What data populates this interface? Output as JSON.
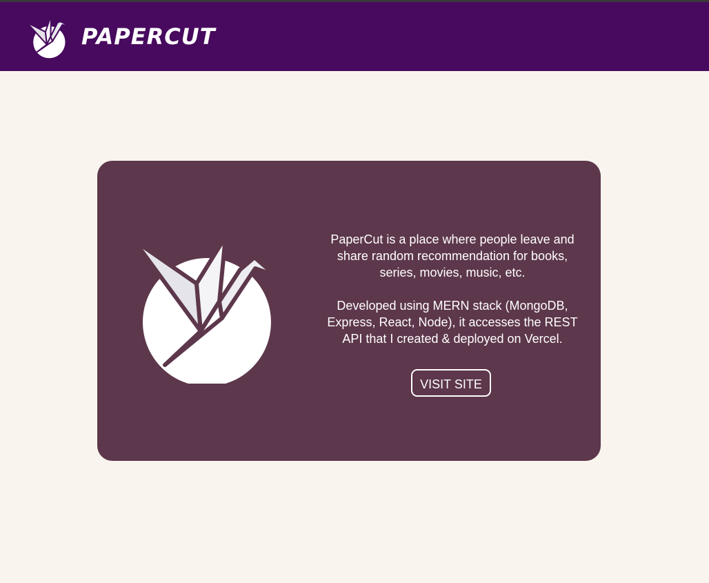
{
  "header": {
    "brand": "PAPERCUT",
    "logo_icon": "origami-crane-icon",
    "background": "#470a5e"
  },
  "project": {
    "logo_icon": "origami-crane-icon",
    "description": "PaperCut is a place where people leave and share random recommendation for books, series, movies, music, etc.",
    "tech": "Developed using MERN stack (MongoDB, Express, React, Node), it accesses the REST API that I created & deployed on Vercel.",
    "visit_label": "VISIT SITE",
    "card_color": "#5d374b"
  },
  "page": {
    "background": "#f9f5ee"
  }
}
